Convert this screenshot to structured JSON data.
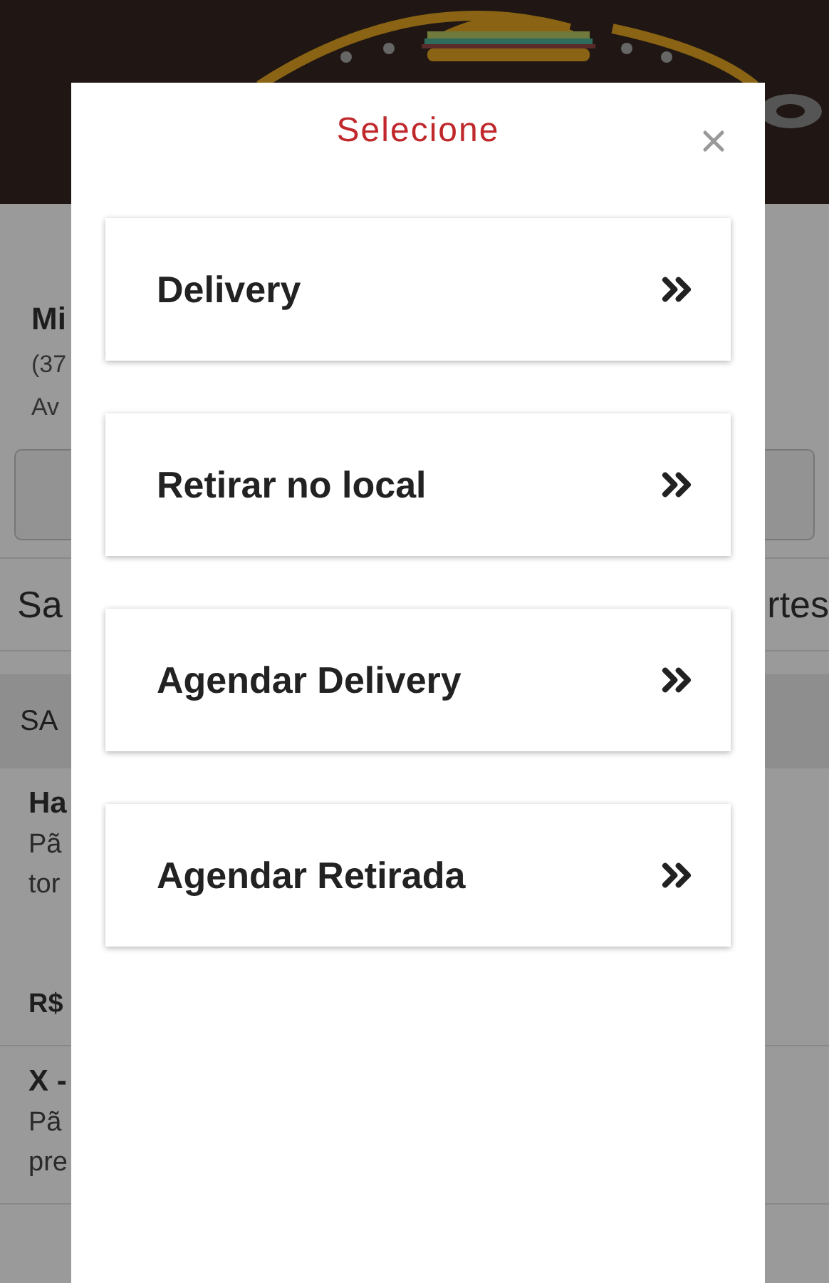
{
  "store": {
    "name": "Mi",
    "phone": "(37",
    "address": "Av"
  },
  "category_tabs": [
    {
      "label": "Sa"
    },
    {
      "label": "rtes"
    }
  ],
  "section": {
    "title": "SA"
  },
  "products": [
    {
      "name": "Ha",
      "description": [
        "Pã",
        "tor"
      ],
      "price": "R$"
    },
    {
      "name": "X -",
      "description": [
        "Pã",
        "pre"
      ]
    }
  ],
  "modal": {
    "title": "Selecione",
    "options": [
      {
        "label": "Delivery"
      },
      {
        "label": "Retirar no local"
      },
      {
        "label": "Agendar Delivery"
      },
      {
        "label": "Agendar Retirada"
      }
    ]
  }
}
